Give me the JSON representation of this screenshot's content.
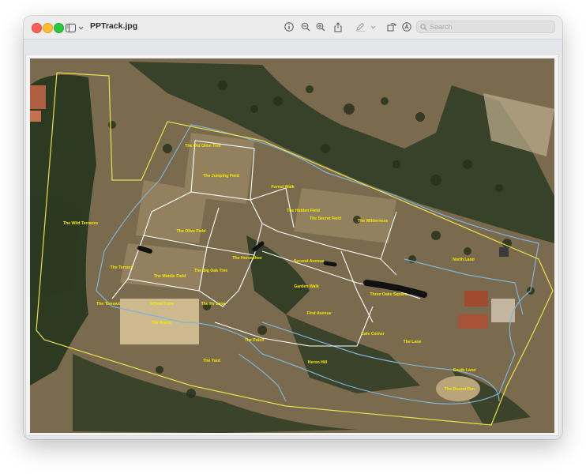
{
  "window": {
    "title": "PPTrack.jpg",
    "search_placeholder": "Search"
  },
  "toolbar": {
    "icons": [
      "sidebar-toggle-icon",
      "chevron-down-icon",
      "info-icon",
      "zoom-out-icon",
      "zoom-in-icon",
      "share-icon",
      "markup-pen-icon",
      "chevron-down-icon",
      "rotate-icon",
      "annotate-icon",
      "search-icon"
    ]
  },
  "colors": {
    "property_boundary": "#e8e04a",
    "paddock_lines": "#ffffff",
    "track_edge": "#7fb3d6",
    "label_text": "#f5e800"
  },
  "map_labels": {
    "old_olive_tree": "The Old Olive Tree",
    "jumping_field": "The Jumping Field",
    "forest_walk": "Forest Walk",
    "hidden_field": "The Hidden Field",
    "secret_field": "The Secret Field",
    "wilderness": "The Wilderness",
    "wild_terraces": "The Wild Terraces",
    "olive_field": "The Olive Field",
    "terrace": "The Terrace",
    "middle_field": "The Middle Field",
    "big_oak_tree": "The Big Oak Tree",
    "horseshoe": "The Horseshoe",
    "second_avenue": "Second Avenue",
    "garden_walk": "Garden Walk",
    "three_oaks_square": "Three Oaks Square",
    "north_land": "North Land",
    "the_turnout": "The Turnout",
    "school_lane": "School Lane",
    "fir_lane": "The Fir Lane",
    "first_avenue": "First Avenue",
    "cafe_corner": "Cafe Corner",
    "the_arena": "The Arena",
    "the_patch": "The Patch",
    "the_yard": "The Yard",
    "heron_hill": "Heron Hill",
    "the_lane": "The Lane",
    "south_land": "South Land",
    "the_round_pen": "The Round Pen"
  }
}
